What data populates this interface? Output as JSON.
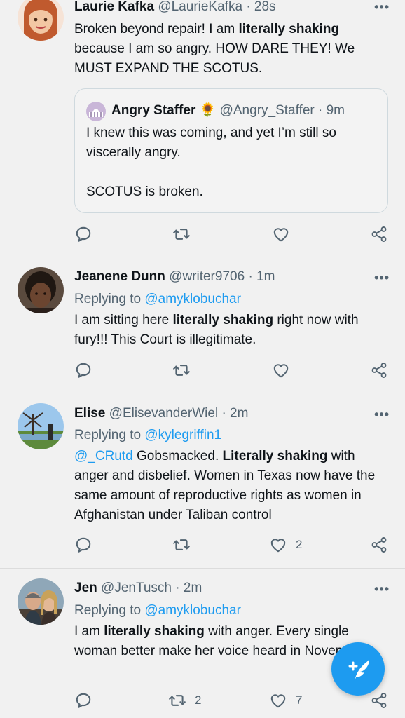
{
  "colors": {
    "accent": "#1d9bf0",
    "secondary_text": "#536471",
    "background": "#f1f1f1"
  },
  "tweets": [
    {
      "name": "Laurie Kafka",
      "handle": "@LaurieKafka",
      "time": "· 28s",
      "body": [
        "Broken beyond repair! I am ",
        "literally shaking",
        " because I am so angry. HOW DARE THEY! We MUST EXPAND THE SCOTUS."
      ],
      "quote": {
        "name": "Angry Staffer",
        "emoji": "🌻",
        "handle": "@Angry_Staffer",
        "time": "· 9m",
        "line1": "I knew this was coming, and yet I’m still so viscerally angry.",
        "line2": "SCOTUS is broken."
      }
    },
    {
      "name": "Jeanene Dunn",
      "handle": "@writer9706",
      "time": "· 1m",
      "replying_prefix": "Replying to ",
      "replying_to": "@amyklobuchar",
      "body": [
        "I am sitting here ",
        "literally shaking",
        " right now with fury!!! This Court is illegitimate."
      ]
    },
    {
      "name": "Elise",
      "handle": "@ElisevanderWiel",
      "time": "· 2m",
      "replying_prefix": "Replying to ",
      "replying_to": "@kylegriffin1",
      "mention": "@_CRutd",
      "body": [
        " Gobsmacked. ",
        "Literally shaking",
        " with anger and disbelief. Women in Texas now have the same amount of reproductive rights as women in Afghanistan under Taliban control"
      ],
      "likes": "2"
    },
    {
      "name": "Jen",
      "handle": "@JenTusch",
      "time": "· 2m",
      "replying_prefix": "Replying to ",
      "replying_to": "@amyklobuchar",
      "body": [
        "I am ",
        "literally shaking",
        " with anger. Every single woman better make her voice heard in November."
      ],
      "retweets": "2",
      "likes": "7"
    }
  ],
  "icons": {
    "reply": "reply-icon",
    "retweet": "retweet-icon",
    "like": "heart-icon",
    "share": "share-icon",
    "more": "more-icon",
    "compose": "compose-tweet-icon"
  },
  "more_glyph": "•••"
}
